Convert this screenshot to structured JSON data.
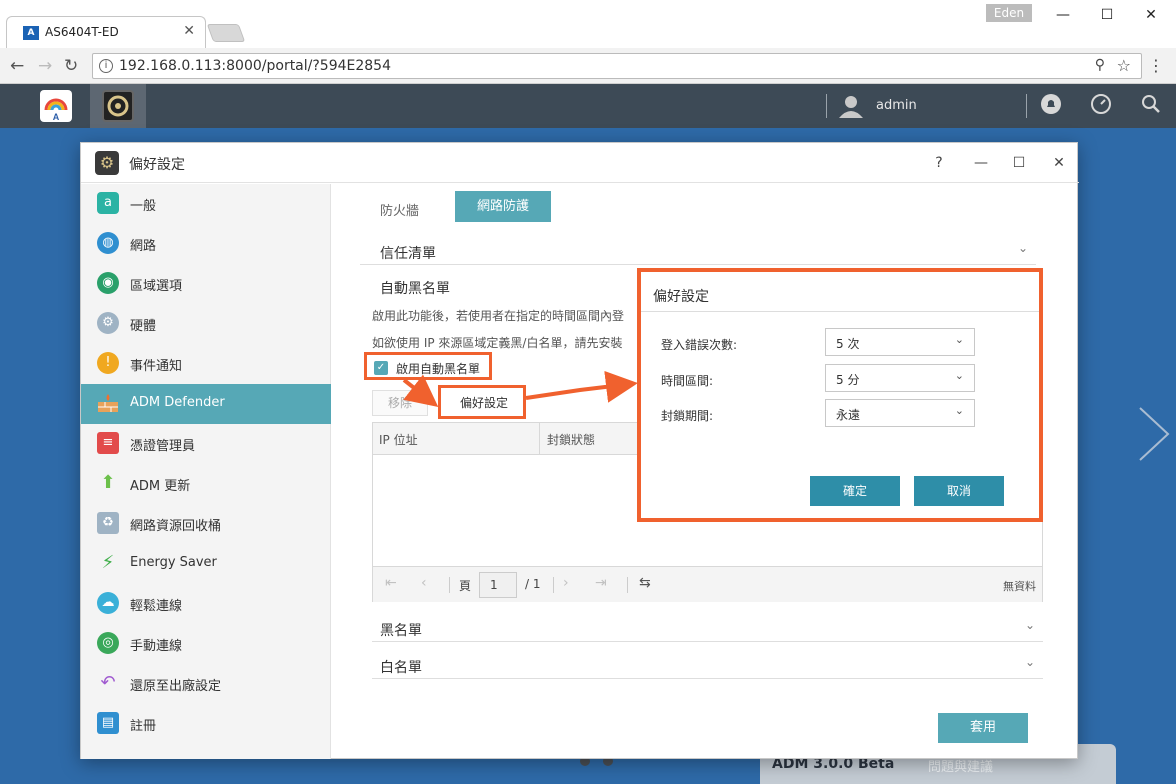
{
  "browser": {
    "tab_title": "AS6404T-ED",
    "tab_favicon": "A",
    "user_badge": "Eden",
    "url": "192.168.0.113:8000/portal/?594E2854",
    "controls": {
      "minimize": "—",
      "maximize": "☐",
      "close": "✕"
    }
  },
  "adm_bar": {
    "user": "admin"
  },
  "window": {
    "title": "偏好設定",
    "help": "?",
    "minimize": "—",
    "maximize": "☐",
    "close": "✕"
  },
  "sidebar": {
    "items": [
      {
        "label": "一般",
        "color": "#2bb3a4"
      },
      {
        "label": "網路",
        "color": "#2f8fd0"
      },
      {
        "label": "區域選項",
        "color": "#2aa06a"
      },
      {
        "label": "硬體",
        "color": "#9fb3c4"
      },
      {
        "label": "事件通知",
        "color": "#f0a820"
      },
      {
        "label": "ADM Defender",
        "color": "#e8a25a"
      },
      {
        "label": "憑證管理員",
        "color": "#e24b4b"
      },
      {
        "label": "ADM 更新",
        "color": "#6cc04a"
      },
      {
        "label": "網路資源回收桶",
        "color": "#9fb3c4"
      },
      {
        "label": "Energy Saver",
        "color": "#3fae49"
      },
      {
        "label": "輕鬆連線",
        "color": "#3ab0d8"
      },
      {
        "label": "手動連線",
        "color": "#3aa85a"
      },
      {
        "label": "還原至出廠設定",
        "color": "#a05ad0"
      },
      {
        "label": "註冊",
        "color": "#2f8fd0"
      }
    ],
    "active_index": 5
  },
  "content": {
    "tabs": [
      "防火牆",
      "網路防護"
    ],
    "trust_list": "信任清單",
    "auto_blacklist_title": "自動黑名單",
    "desc1": "啟用此功能後，若使用者在指定的時間區間內登",
    "desc2": "如欲使用 IP 來源區域定義黑/白名單，請先安裝",
    "checkbox_label": "啟用自動黑名單",
    "checkbox_mark": "✓",
    "remove_button": "移除",
    "pref_button": "偏好設定",
    "grid_headers": [
      "IP 位址",
      "封鎖狀態"
    ],
    "pager": {
      "page_label": "頁",
      "current_page": "1",
      "total_pages": "/ 1",
      "no_data": "無資料"
    },
    "blacklist": "黑名單",
    "whitelist": "白名單",
    "apply_button": "套用"
  },
  "dialog": {
    "title": "偏好設定",
    "rows": [
      {
        "label": "登入錯誤次數:",
        "value": "5 次"
      },
      {
        "label": "時間區間:",
        "value": "5 分"
      },
      {
        "label": "封鎖期間:",
        "value": "永遠"
      }
    ],
    "ok": "確定",
    "cancel": "取消"
  },
  "taskbar": {
    "version": "ADM 3.0.0 Beta",
    "feedback": "問題與建議"
  },
  "colors": {
    "accent": "#56a8b6",
    "highlight": "#f0612e",
    "dialog_button": "#2e8ea8"
  }
}
